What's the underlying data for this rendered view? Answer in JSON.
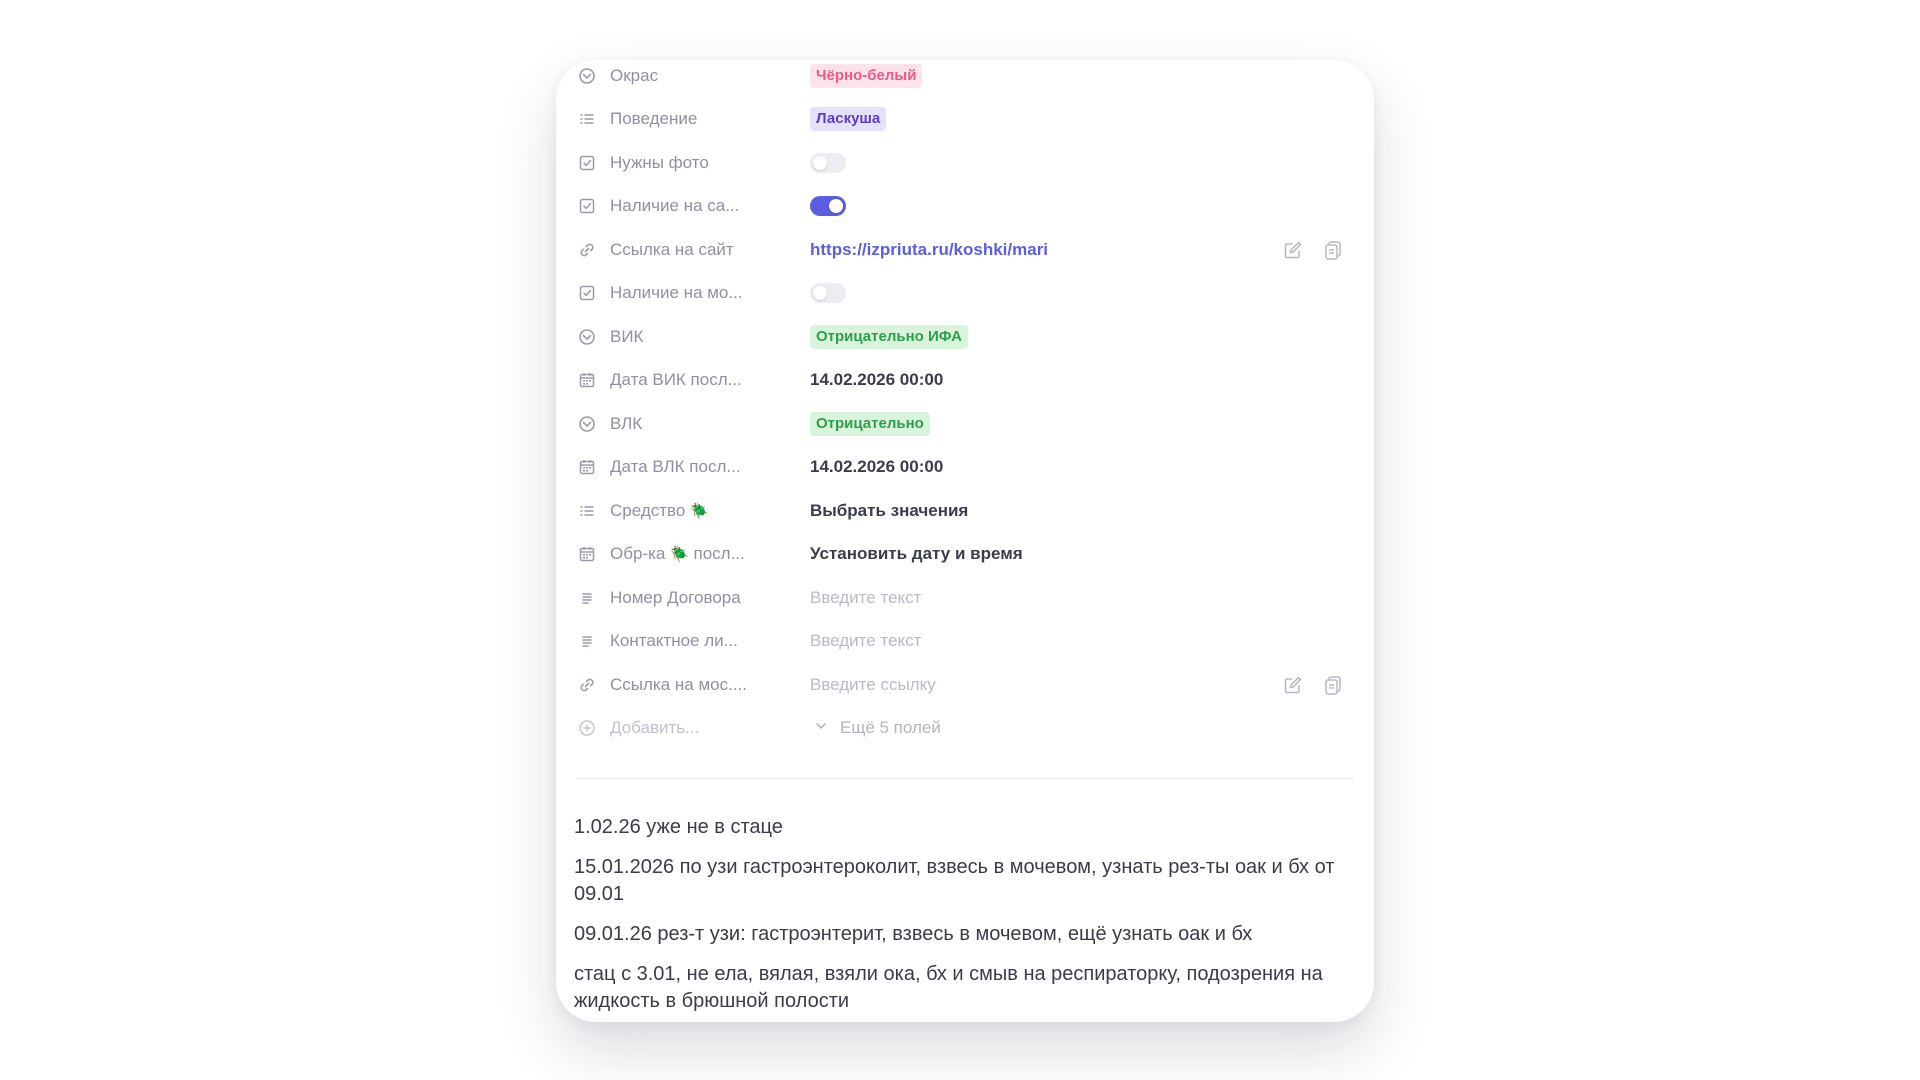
{
  "fields": [
    {
      "key": "okras",
      "label": "Окрас",
      "icon": "status-icon",
      "type": "tag",
      "value": "Чёрно-белый",
      "color": "pink"
    },
    {
      "key": "behavior",
      "label": "Поведение",
      "icon": "list-icon",
      "type": "tag",
      "value": "Ласкуша",
      "color": "purple"
    },
    {
      "key": "need_photo",
      "label": "Нужны фото",
      "icon": "checkbox-icon",
      "type": "toggle",
      "on": false
    },
    {
      "key": "on_site",
      "label": "Наличие на са...",
      "icon": "checkbox-icon",
      "type": "toggle",
      "on": true
    },
    {
      "key": "site_link",
      "label": "Ссылка на сайт",
      "icon": "link-icon",
      "type": "link",
      "value": "https://izpriuta.ru/koshki/mari"
    },
    {
      "key": "on_mo",
      "label": "Наличие на мо...",
      "icon": "checkbox-icon",
      "type": "toggle",
      "on": false
    },
    {
      "key": "vik",
      "label": "ВИК",
      "icon": "status-icon",
      "type": "tag",
      "value": "Отрицательно ИФА",
      "color": "green"
    },
    {
      "key": "vik_date",
      "label": "Дата ВИК посл...",
      "icon": "calendar-icon",
      "type": "bold",
      "value": "14.02.2026 00:00"
    },
    {
      "key": "vlk",
      "label": "ВЛК",
      "icon": "status-icon",
      "type": "tag",
      "value": "Отрицательно",
      "color": "green"
    },
    {
      "key": "vlk_date",
      "label": "Дата ВЛК посл...",
      "icon": "calendar-icon",
      "type": "bold",
      "value": "14.02.2026 00:00"
    },
    {
      "key": "remedy",
      "label": "Средство",
      "beetle": "🪲",
      "icon": "list-icon",
      "type": "bold",
      "value": "Выбрать значения"
    },
    {
      "key": "treatment",
      "label": "Обр-ка",
      "beetle": "🪲",
      "label_suffix": "посл...",
      "icon": "calendar-icon",
      "type": "bold",
      "value": "Установить дату и время"
    },
    {
      "key": "contract",
      "label": "Номер Договора",
      "icon": "text-icon",
      "type": "placeholder",
      "value": "Введите текст"
    },
    {
      "key": "contact",
      "label": "Контактное ли...",
      "icon": "text-icon",
      "type": "placeholder",
      "value": "Введите текст"
    },
    {
      "key": "mos_link",
      "label": "Ссылка на мос....",
      "icon": "link-icon",
      "type": "link-placeholder",
      "value": "Введите ссылку"
    }
  ],
  "add_field": {
    "label": "Добавить...",
    "more": "Ещё 5 полей"
  },
  "notes": [
    "1.02.26 уже не в стаце",
    "15.01.2026 по узи гастроэнтероколит, взвесь в мочевом, узнать рез-ты оак и бх от 09.01",
    "09.01.26 рез-т узи: гастроэнтерит, взвесь в мочевом, ещё узнать оак и бх",
    "стац с 3.01, не ела, вялая, взяли ока, бх и смыв на респираторку, подозрения на жидкость в брюшной полости"
  ],
  "colors": {
    "accent": "#5b5ee0",
    "pink_tag": "#fde2ea",
    "purple_tag": "#e6e1fb",
    "green_tag": "#d8f5dc"
  }
}
